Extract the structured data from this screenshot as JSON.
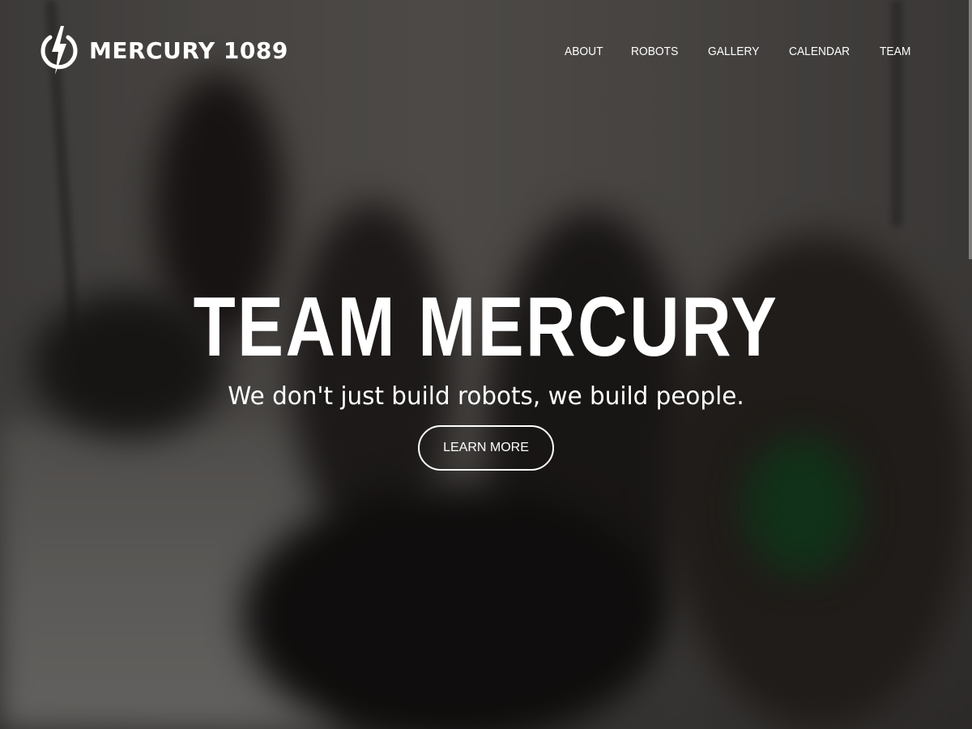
{
  "brand": {
    "name": "MERCURY 1089",
    "logo_icon": "lightning-bolt-circle-icon"
  },
  "nav": {
    "items": [
      {
        "label": "ABOUT"
      },
      {
        "label": "ROBOTS"
      },
      {
        "label": "GALLERY"
      },
      {
        "label": "CALENDAR"
      },
      {
        "label": "TEAM"
      }
    ]
  },
  "hero": {
    "title": "TEAM MERCURY",
    "subtitle": "We don't just build robots, we build people.",
    "cta_label": "LEARN MORE",
    "background": "blurred photo of team members sitting along a wall"
  },
  "colors": {
    "text": "#ffffff",
    "overlay": "#000000"
  }
}
